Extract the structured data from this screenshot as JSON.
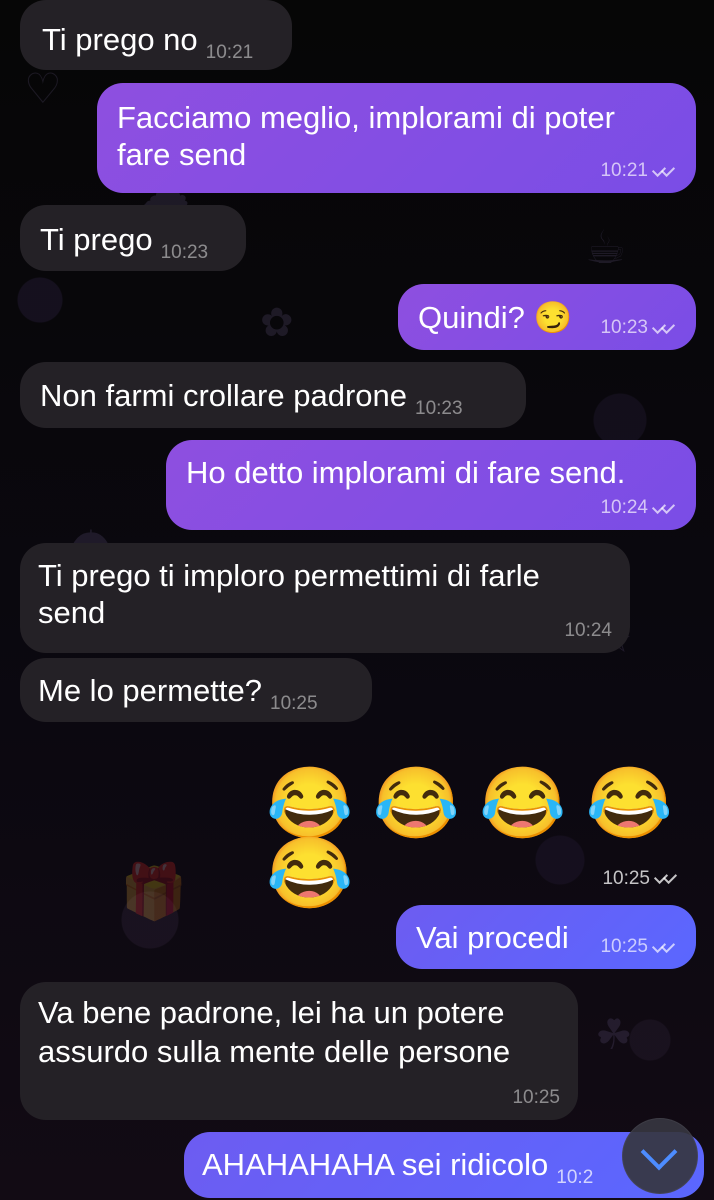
{
  "messages": [
    {
      "text": "Ti prego no",
      "time": "10:21"
    },
    {
      "text": "Facciamo meglio, implorami di poter fare send",
      "time": "10:21"
    },
    {
      "text": "Ti prego",
      "time": "10:23"
    },
    {
      "text": "Quindi? 😏",
      "time": "10:23"
    },
    {
      "text": "Non farmi crollare padrone",
      "time": "10:23"
    },
    {
      "text": "Ho detto implorami di fare send.",
      "time": "10:24"
    },
    {
      "text": "Ti prego ti imploro permettimi di farle send",
      "time": "10:24"
    },
    {
      "text": "Me lo permette?",
      "time": "10:25"
    },
    {
      "text": "😂 😂 😂 😂 😂",
      "time": "10:25"
    },
    {
      "text": "Vai procedi",
      "time": "10:25"
    },
    {
      "text": "Va bene padrone, lei ha un potere assurdo sulla mente delle persone",
      "time": "10:25"
    },
    {
      "text": "AHAHAHAHA sei ridicolo",
      "time": "10:2"
    }
  ]
}
